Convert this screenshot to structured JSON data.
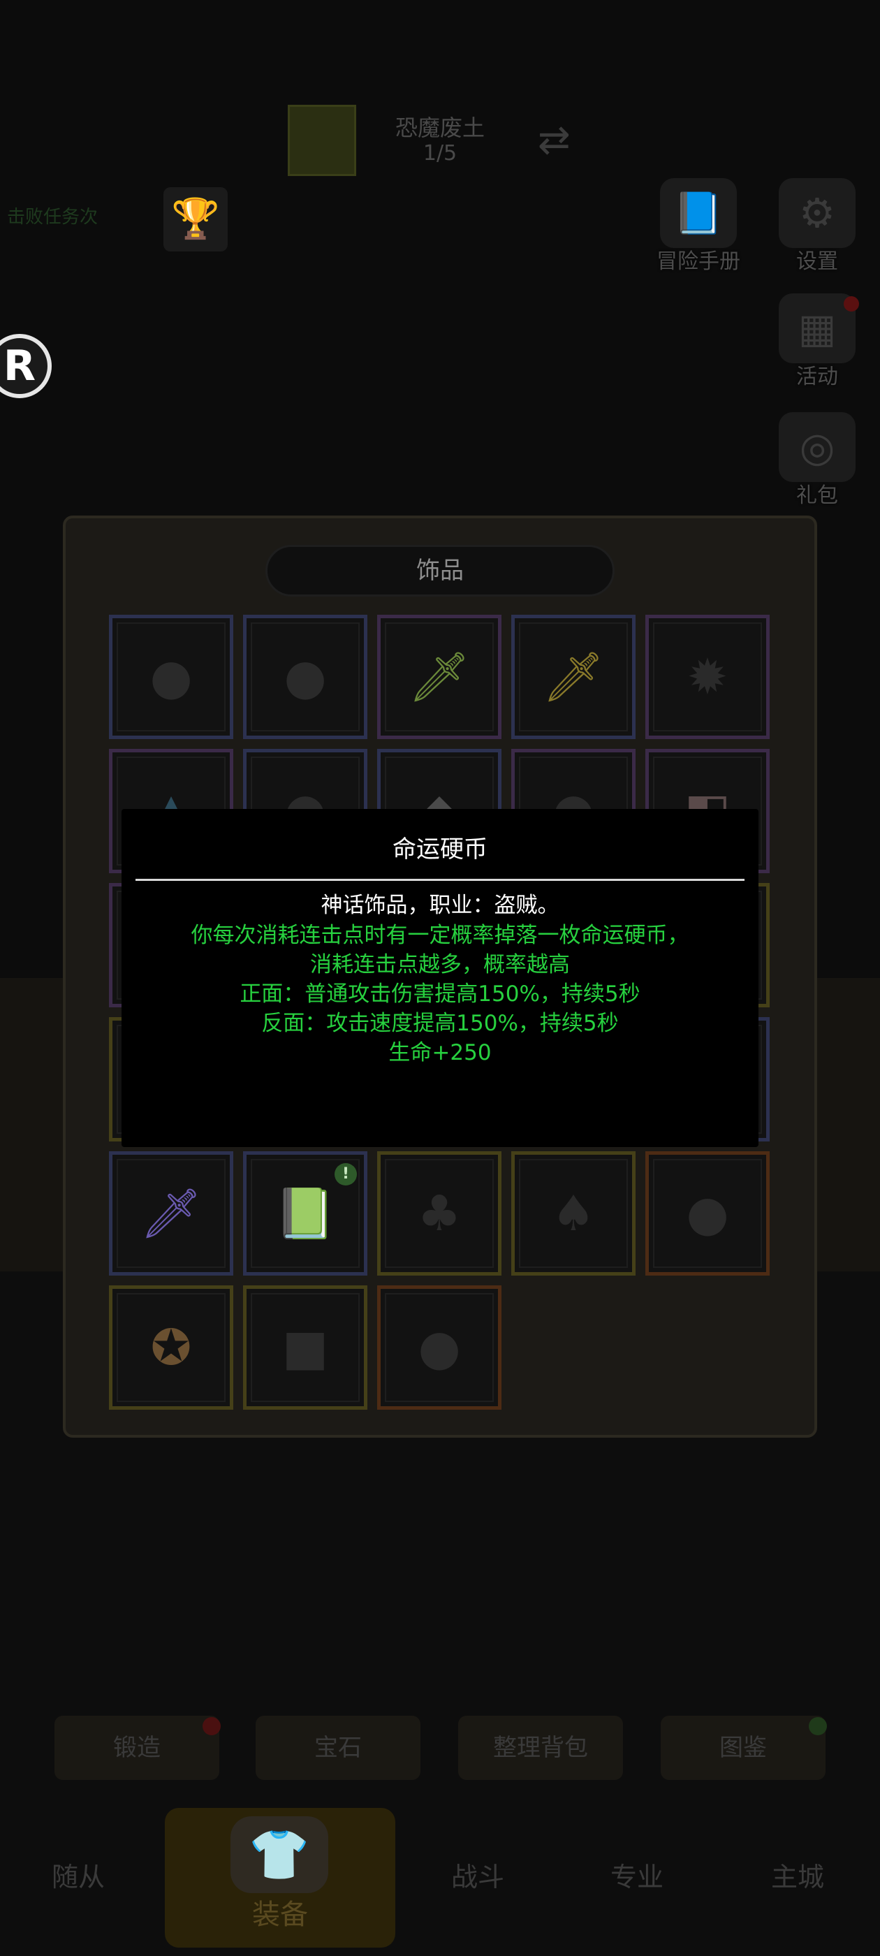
{
  "zone": {
    "name": "恐魔废土",
    "progress": "1/5",
    "quest_text": "击败任务次"
  },
  "side_buttons": [
    {
      "label": "冒险手册",
      "icon": "book-icon"
    },
    {
      "label": "设置",
      "icon": "gear-icon"
    },
    {
      "label": "活动",
      "icon": "calendar-icon"
    },
    {
      "label": "礼包",
      "icon": "gift-icon"
    }
  ],
  "panel": {
    "title": "饰品"
  },
  "tooltip": {
    "title": "命运硬币",
    "subtitle": "神话饰品，职业：盗贼。",
    "lines": [
      "你每次消耗连击点时有一定概率掉落一枚命运硬币，",
      "消耗连击点越多，概率越高",
      "正面：普通攻击伤害提高150%，持续5秒",
      "反面：攻击速度提高150%，持续5秒",
      "生命+250"
    ]
  },
  "actions": [
    "锻造",
    "宝石",
    "整理背包",
    "图鉴"
  ],
  "nav": [
    "随从",
    "装备",
    "战斗",
    "专业",
    "主城"
  ],
  "colors": {
    "tooltip_text": "#27d13f",
    "tooltip_title": "#ffffff"
  }
}
